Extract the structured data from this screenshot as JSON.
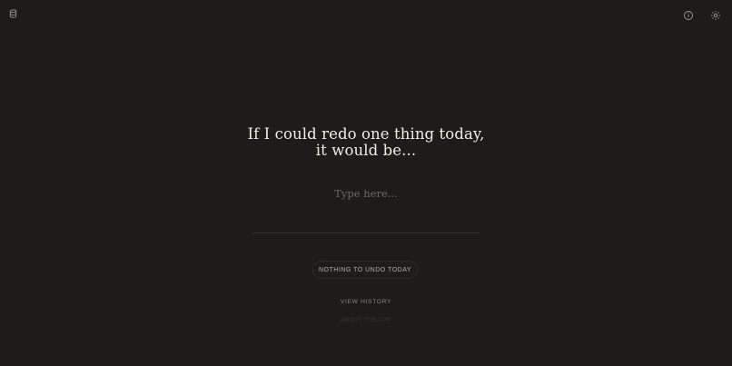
{
  "header": {
    "left_icon": "database-icon",
    "right_icons": [
      "info-icon",
      "sun-icon"
    ]
  },
  "main": {
    "prompt_line_1": "If I could redo one thing today,",
    "prompt_line_2": "it would be...",
    "input_placeholder": "Type here...",
    "undo_button_label": "NOTHING TO UNDO TODAY",
    "history_link_label": "VIEW HISTORY",
    "faint_link_label": "ABOUT THE APP"
  },
  "colors": {
    "background": "#1f1b1a",
    "text": "#f2ece4",
    "muted": "#8a8380"
  }
}
